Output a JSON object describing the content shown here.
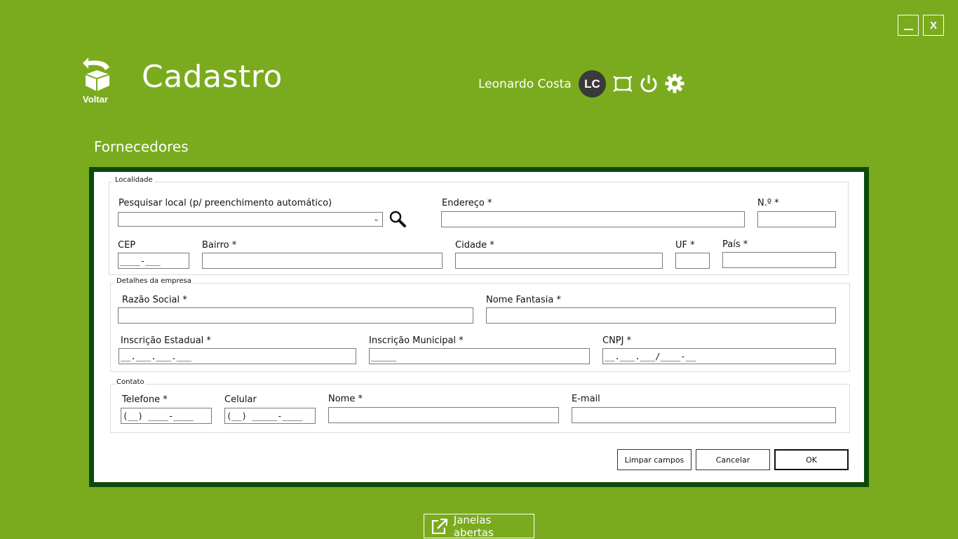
{
  "window": {
    "minimize_label": "_",
    "close_label": "X"
  },
  "header": {
    "back_label": "Voltar",
    "title": "Cadastro",
    "user_name": "Leonardo Costa",
    "avatar_initials": "LC",
    "icons": [
      "fullscreen-icon",
      "power-icon",
      "gear-icon"
    ]
  },
  "section_title": "Fornecedores",
  "form": {
    "localidade": {
      "legend": "Localidade",
      "search_label": "Pesquisar local (p/ preenchimento automático)",
      "endereco_label": "Endereço *",
      "numero_label": "N.º *",
      "cep_label": "CEP",
      "cep_value": "____-___",
      "bairro_label": "Bairro *",
      "cidade_label": "Cidade *",
      "uf_label": "UF *",
      "pais_label": "País *"
    },
    "empresa": {
      "legend": "Detalhes da empresa",
      "razao_label": "Razão Social *",
      "fantasia_label": "Nome Fantasia *",
      "ie_label": "Inscrição Estadual *",
      "ie_value": "__.___.___.___",
      "im_label": "Inscrição Municipal *",
      "im_value": "_____",
      "cnpj_label": "CNPJ *",
      "cnpj_value": "__.___.___/____-__"
    },
    "contato": {
      "legend": "Contato",
      "telefone_label": "Telefone *",
      "telefone_value": "(__) ____-____",
      "celular_label": "Celular",
      "celular_value": "(__) _____-____",
      "nome_label": "Nome *",
      "email_label": "E-mail"
    },
    "buttons": {
      "clear": "Limpar campos",
      "cancel": "Cancelar",
      "ok": "OK"
    }
  },
  "footer": {
    "open_windows_label": "Janelas abertas"
  },
  "colors": {
    "background": "#7aab1e",
    "panel_border": "#0b4a0b",
    "avatar": "#3a3a3a"
  }
}
